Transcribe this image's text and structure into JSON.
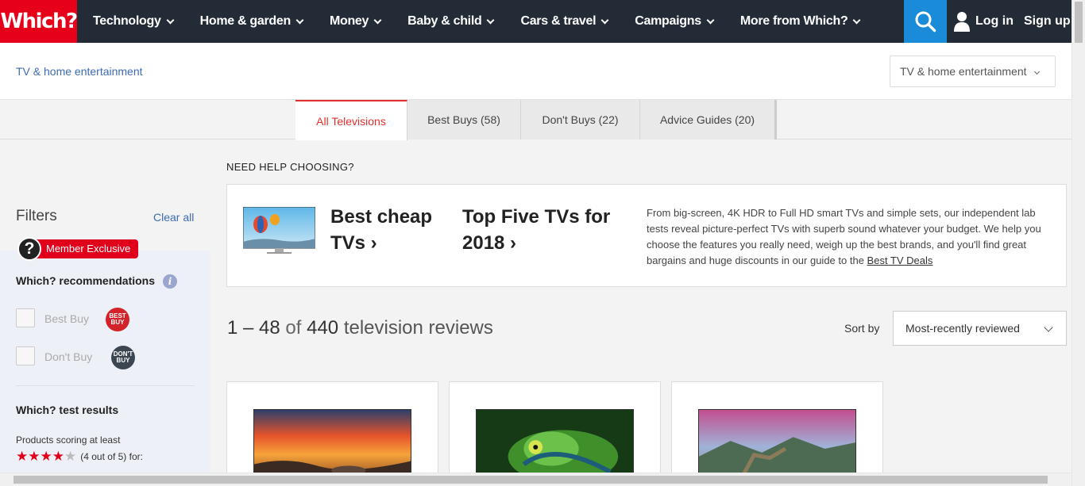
{
  "brand": {
    "logo_text": "Which?",
    "accent": "#e60019",
    "nav_bg": "#222b36",
    "search_bg": "#1a8bd8"
  },
  "nav": {
    "items": [
      {
        "label": "Technology"
      },
      {
        "label": "Home & garden"
      },
      {
        "label": "Money"
      },
      {
        "label": "Baby & child"
      },
      {
        "label": "Cars & travel"
      },
      {
        "label": "Campaigns"
      },
      {
        "label": "More from Which?"
      }
    ],
    "login": "Log in",
    "signup": "Sign up"
  },
  "subheader": {
    "breadcrumb": "TV & home entertainment",
    "category_select": "TV & home entertainment"
  },
  "tabs": [
    {
      "label": "All Televisions",
      "active": true
    },
    {
      "label": "Best Buys (58)"
    },
    {
      "label": "Don't Buys (22)"
    },
    {
      "label": "Advice Guides (20)"
    }
  ],
  "filters": {
    "title": "Filters",
    "clear_all": "Clear all",
    "member_icon": "?",
    "member_badge": "Member Exclusive",
    "recommendations_title": "Which? recommendations",
    "info_icon": "i",
    "best_buy_label": "Best Buy",
    "best_buy_badge": "BEST BUY",
    "dont_buy_label": "Don't Buy",
    "dont_buy_badge": "DON'T BUY",
    "test_results_title": "Which? test results",
    "scoring_label": "Products scoring at least",
    "star_rating": 4,
    "star_max": 5,
    "star_text": "(4 out of 5) for:"
  },
  "promo": {
    "heading": "NEED HELP CHOOSING?",
    "link1": "Best cheap TVs",
    "link2": "Top Five TVs for 2018",
    "description": "From big-screen, 4K HDR to Full HD smart TVs and simple sets, our independent lab tests reveal picture-perfect TVs with superb sound whatever your budget. We help you choose the features you really need, weigh up the best brands, and you'll find great bargains and huge discounts in our guide to the",
    "description_link": "Best TV Deals"
  },
  "results": {
    "range": "1 – 48",
    "of": "of",
    "total": "440",
    "suffix": "television reviews",
    "sort_label": "Sort by",
    "sort_value": "Most-recently reviewed"
  }
}
